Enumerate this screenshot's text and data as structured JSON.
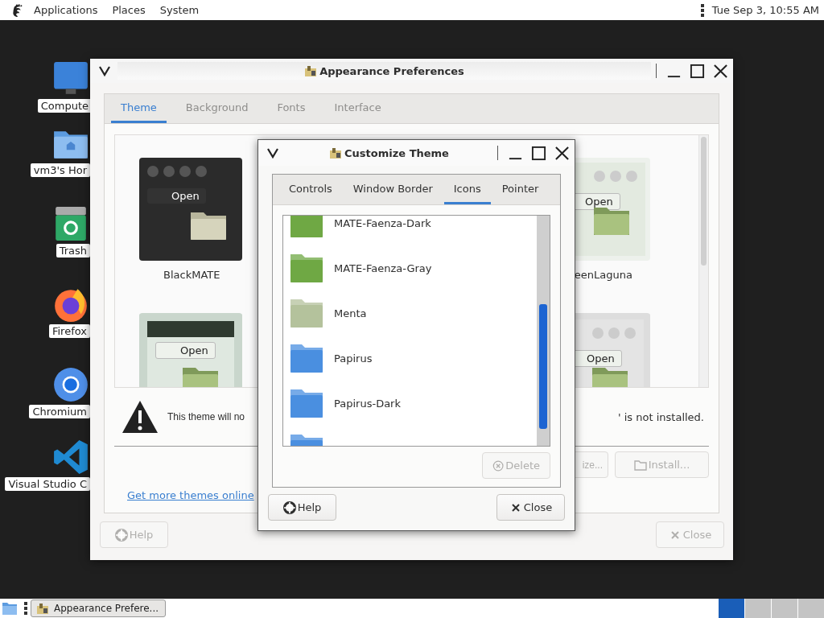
{
  "top_panel": {
    "menus": [
      "Applications",
      "Places",
      "System"
    ],
    "clock": "Tue Sep  3, 10:55 AM"
  },
  "desktop_icons": [
    {
      "label": "Compute",
      "kind": "computer"
    },
    {
      "label": "vm3's Hor",
      "kind": "home"
    },
    {
      "label": "Trash",
      "kind": "trash"
    },
    {
      "label": "Firefox",
      "kind": "firefox"
    },
    {
      "label": "Chromium",
      "kind": "chromium"
    },
    {
      "label": "Visual Studio C",
      "kind": "vscode"
    }
  ],
  "main_window": {
    "title": "Appearance Preferences",
    "tabs": [
      {
        "label": "Theme",
        "selected": true,
        "disabled": false
      },
      {
        "label": "Background",
        "selected": false,
        "disabled": true
      },
      {
        "label": "Fonts",
        "selected": false,
        "disabled": true
      },
      {
        "label": "Interface",
        "selected": false,
        "disabled": true
      }
    ],
    "themes": [
      {
        "name": "BlackMATE",
        "kind": "dark",
        "sample": "Open"
      },
      {
        "name": "eenLaguna",
        "kind": "laguna",
        "sample": "Open"
      },
      {
        "kind": "green",
        "sample": "Open"
      },
      {
        "kind": "grey",
        "sample": "Open"
      }
    ],
    "warning": {
      "text_left": "This theme will no",
      "text_right": "' is not installed."
    },
    "actions": [
      {
        "label": "ize...",
        "disabled": true
      },
      {
        "label": "Install...",
        "disabled": true
      }
    ],
    "link": "Get more themes online",
    "footer": [
      {
        "label": "Help",
        "disabled": true
      },
      {
        "label": "Close",
        "disabled": true
      }
    ]
  },
  "dialog": {
    "title": "Customize Theme",
    "tabs": [
      {
        "label": "Controls",
        "selected": false
      },
      {
        "label": "Window Border",
        "selected": false
      },
      {
        "label": "Icons",
        "selected": true
      },
      {
        "label": "Pointer",
        "selected": false
      }
    ],
    "icon_themes": [
      {
        "name": "MATE-Faenza-Dark",
        "color": "#6fa844"
      },
      {
        "name": "MATE-Faenza-Gray",
        "color": "#6fa844"
      },
      {
        "name": "Menta",
        "color": "#b4c29c"
      },
      {
        "name": "Papirus",
        "color": "#4a8fe0"
      },
      {
        "name": "Papirus-Dark",
        "color": "#4a8fe0"
      },
      {
        "color": "#4a8fe0"
      }
    ],
    "delete": {
      "label": "Delete",
      "disabled": true
    },
    "footer": [
      {
        "label": "Help",
        "disabled": false
      },
      {
        "label": "Close",
        "disabled": false
      }
    ]
  },
  "taskbar": {
    "tasks": [
      {
        "label": "Appearance Prefere...",
        "selected": false
      }
    ],
    "workspaces": [
      {
        "selected": true
      },
      {
        "selected": false
      },
      {
        "selected": false
      },
      {
        "selected": false
      }
    ]
  }
}
